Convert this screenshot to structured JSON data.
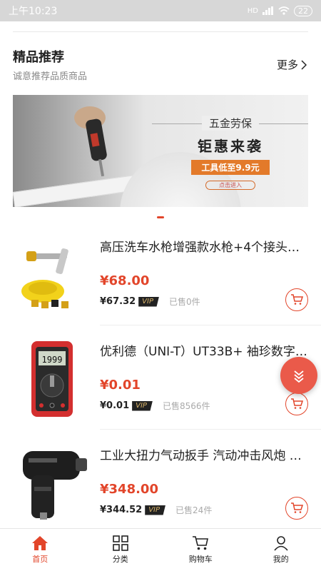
{
  "status_bar": {
    "time": "上午10:23",
    "network": "HD",
    "battery": "22"
  },
  "section": {
    "title": "精品推荐",
    "subtitle": "诚意推荐品质商品",
    "more_label": "更多"
  },
  "banner": {
    "line1": "五金劳保",
    "line2": "钜惠来袭",
    "line3": "工具低至9.9元",
    "button": "点击进入"
  },
  "products": [
    {
      "name": "高压洗车水枪增强款水枪+4个接头…",
      "price": "¥68.00",
      "member_price": "¥67.32",
      "vip_label": "VIP",
      "sold": "已售0件"
    },
    {
      "name": "优利德（UNI-T）UT33B+ 袖珍数字…",
      "price": "¥0.01",
      "member_price": "¥0.01",
      "vip_label": "VIP",
      "sold": "已售8566件"
    },
    {
      "name": "工业大扭力气动扳手 汽动冲击风炮 …",
      "price": "¥348.00",
      "member_price": "¥344.52",
      "vip_label": "VIP",
      "sold": "已售24件"
    }
  ],
  "tabbar": [
    {
      "label": "首页",
      "icon": "home-icon",
      "active": true
    },
    {
      "label": "分类",
      "icon": "grid-icon",
      "active": false
    },
    {
      "label": "购物车",
      "icon": "cart-icon",
      "active": false
    },
    {
      "label": "我的",
      "icon": "user-icon",
      "active": false
    }
  ],
  "colors": {
    "accent": "#e2452a",
    "fab": "#ea5a4a",
    "status_bar": "#d7d7d7"
  }
}
